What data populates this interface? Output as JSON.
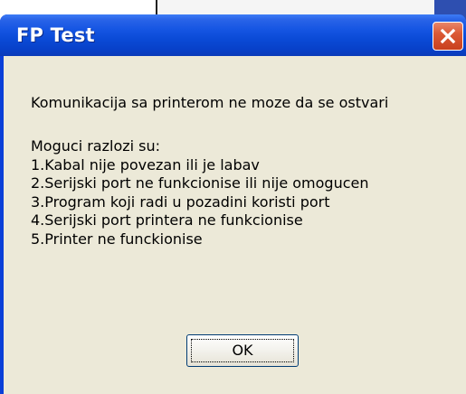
{
  "window": {
    "title": "FP Test"
  },
  "titlebar": {
    "close_icon": "close-x-icon"
  },
  "message": {
    "headline": "Komunikacija sa printerom ne moze da se ostvari",
    "reasons_heading": "Moguci razlozi su:",
    "reasons": [
      "1.Kabal nije povezan ili je labav",
      "2.Serijski port ne funkcionise ili nije omogucen",
      "3.Program koji radi u pozadini koristi port",
      "4.Serijski port printera ne funkcionise",
      "5.Printer ne funckionise"
    ]
  },
  "buttons": {
    "ok_label": "OK"
  },
  "colors": {
    "titlebar": "#0a4ad6",
    "client_background": "#ece9d8",
    "close_button": "#dc5a36",
    "text": "#000000"
  }
}
